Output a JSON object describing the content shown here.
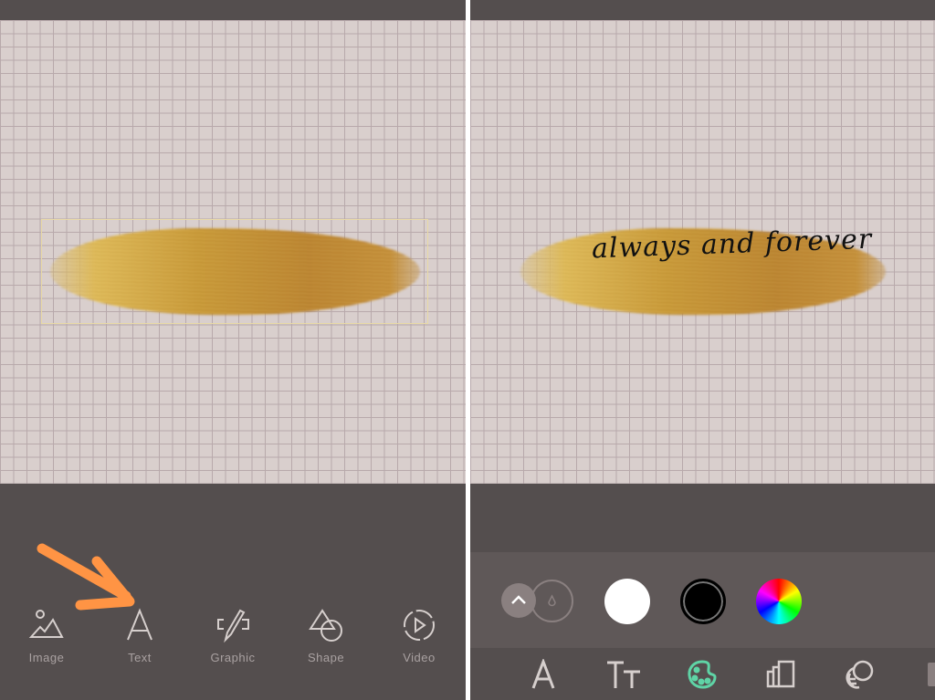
{
  "left_panel": {
    "toolbar": [
      {
        "label": "Image",
        "icon": "image-icon"
      },
      {
        "label": "Text",
        "icon": "text-icon"
      },
      {
        "label": "Graphic",
        "icon": "graphic-icon"
      },
      {
        "label": "Shape",
        "icon": "shape-icon"
      },
      {
        "label": "Video",
        "icon": "video-icon"
      }
    ],
    "annotation_arrow_color": "#ff9444"
  },
  "right_panel": {
    "canvas_text": "always and forever",
    "color_options": [
      {
        "name": "white",
        "color": "#ffffff"
      },
      {
        "name": "black",
        "color": "#000000",
        "selected": true
      },
      {
        "name": "color-wheel"
      }
    ],
    "bottom_tools": [
      "font-icon",
      "text-size-icon",
      "palette-icon",
      "alignment-icon",
      "effects-icon"
    ],
    "active_tool": "palette-icon",
    "accent_color": "#5fd4a6"
  }
}
